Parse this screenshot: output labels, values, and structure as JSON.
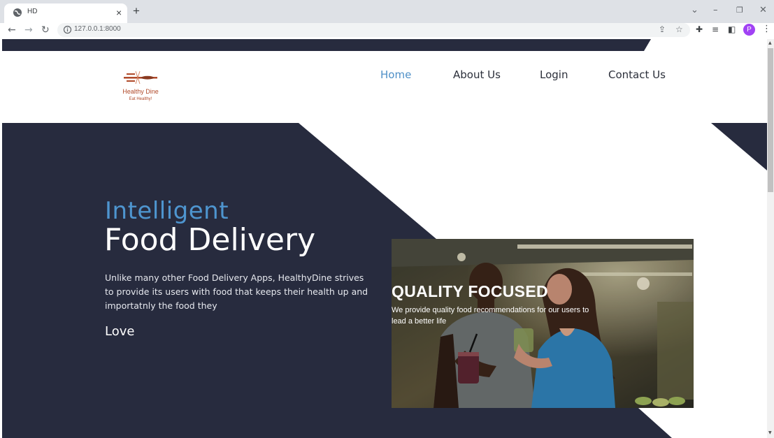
{
  "browser": {
    "tab_title": "HD",
    "tab_close": "×",
    "new_tab": "+",
    "url": "127.0.0.1:8000",
    "avatar_letter": "P",
    "window_controls": [
      "chevron-down-icon",
      "minimize-icon",
      "restore-icon",
      "close-icon"
    ]
  },
  "site": {
    "logo_name": "Healthy Dine",
    "logo_tagline": "Eat Healthy!",
    "nav": [
      {
        "label": "Home",
        "active": true
      },
      {
        "label": "About Us",
        "active": false
      },
      {
        "label": "Login",
        "active": false
      },
      {
        "label": "Contact Us",
        "active": false
      }
    ]
  },
  "hero": {
    "kicker": "Intelligent",
    "title": "Food Delivery",
    "description": "Unlike many other Food Delivery Apps, HealthyDine strives to provide its users with food that keeps their health up and importatnly the food they",
    "love": "Love"
  },
  "feature": {
    "heading": "QUALITY FOCUSED",
    "text": "We provide quality food recommendations for our users to lead a better life"
  },
  "colors": {
    "navy": "#272b3e",
    "accent_blue": "#4e95cf",
    "nav_active": "#4e8fc7",
    "logo_brown": "#b04a2a"
  }
}
